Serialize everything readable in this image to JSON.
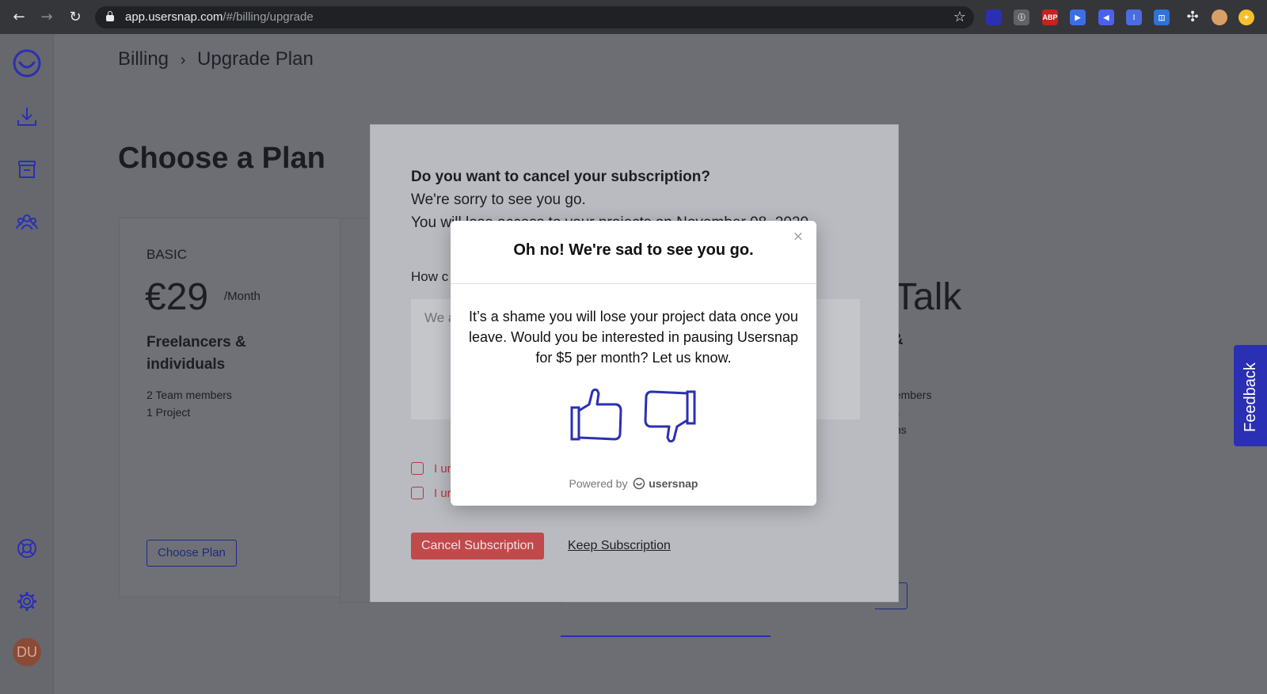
{
  "browser": {
    "url_host": "app.usersnap.com",
    "url_path": "/#/billing/upgrade",
    "extensions": [
      {
        "name": "usersnap-ext-icon",
        "label": "",
        "color": "#2b2fb4"
      },
      {
        "name": "info-ext-icon",
        "label": "ⓘ",
        "color": "#5f6368"
      },
      {
        "name": "adblock-plus-icon",
        "label": "ABP",
        "color": "#c5221f"
      },
      {
        "name": "arrow-ext-icon",
        "label": "▶",
        "color": "#3b6fe8"
      },
      {
        "name": "compass-ext-icon",
        "label": "◀",
        "color": "#4a61ee"
      },
      {
        "name": "grid-ext-icon",
        "label": "⁞",
        "color": "#4b6be0"
      },
      {
        "name": "screen-ext-icon",
        "label": "◫",
        "color": "#2f72d8"
      }
    ]
  },
  "breadcrumb": {
    "parent": "Billing",
    "separator": "›",
    "current": "Upgrade Plan"
  },
  "page": {
    "title": "Choose a Plan"
  },
  "plans": {
    "basic": {
      "name": "BASIC",
      "price": "€29",
      "period": "/Month",
      "audience": "Freelancers & individuals",
      "features": [
        "2 Team members",
        "1 Project"
      ],
      "button": "Choose Plan"
    },
    "talk": {
      "price_label": "Talk",
      "audience_partial": "s &",
      "features_partial": [
        "nembers",
        "s",
        "ns"
      ]
    }
  },
  "sidebar": {
    "avatar_initials": "DU"
  },
  "feedback_tab": "Feedback",
  "cancel_modal": {
    "question": "Do you want to cancel your subscription?",
    "line1": "We're sorry to see you go.",
    "line2": "You will lose access to your projects on November 08, 2020.",
    "how_label": "How c",
    "textarea_placeholder": "We a",
    "checkbox1_label": "I ur",
    "checkbox2_label": "I ur",
    "cancel_button": "Cancel Subscription",
    "keep_link": "Keep Subscription"
  },
  "survey_popup": {
    "title": "Oh no! We're sad to see you go.",
    "message": "It’s a shame you will lose your project data once you leave. Would you be interested in pausing Usersnap for $5 per month? Let us know.",
    "close": "×",
    "powered_by": "Powered by",
    "brand": "usersnap"
  },
  "colors": {
    "brand": "#2b2fb4",
    "danger": "#c0494c"
  }
}
